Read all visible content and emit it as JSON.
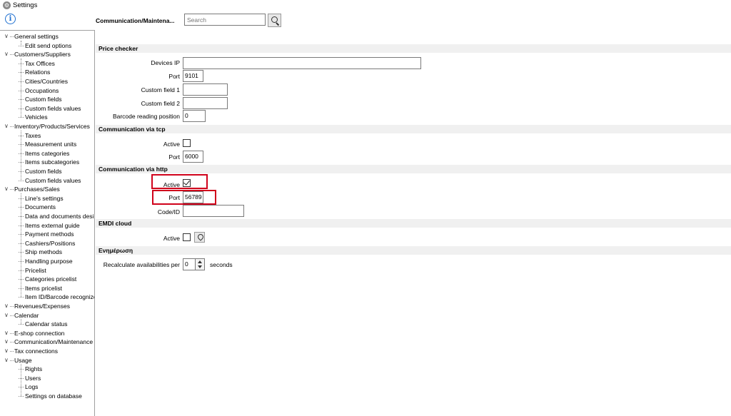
{
  "window": {
    "title": "Settings"
  },
  "header": {
    "breadcrumb": "Communication/Maintena...",
    "search_placeholder": "Search"
  },
  "tree": [
    {
      "label": "General settings",
      "children": [
        "Edit send options"
      ]
    },
    {
      "label": "Customers/Suppliers",
      "children": [
        "Tax Offices",
        "Relations",
        "Cities/Countries",
        "Occupations",
        "Custom fields",
        "Custom fields values",
        "Vehicles"
      ]
    },
    {
      "label": "Inventory/Products/Services",
      "children": [
        "Taxes",
        "Measurement units",
        "Items categories",
        "Items subcategories",
        "Custom fields",
        "Custom fields values"
      ]
    },
    {
      "label": "Purchases/Sales",
      "children": [
        "Line's settings",
        "Documents",
        "Data and documents desi",
        "Items external guide",
        "Payment methods",
        "Cashiers/Positions",
        "Ship methods",
        "Handling purpose",
        "Pricelist",
        "Categories pricelist",
        "Items pricelist",
        "Item ID/Barcode recognize"
      ]
    },
    {
      "label": "Revenues/Expenses",
      "children": []
    },
    {
      "label": "Calendar",
      "children": [
        "Calendar status"
      ]
    },
    {
      "label": "E-shop connection",
      "children": []
    },
    {
      "label": "Communication/Maintenance",
      "children": []
    },
    {
      "label": "Tax connections",
      "children": []
    },
    {
      "label": "Usage",
      "children": [
        "Rights",
        "Users",
        "Logs",
        "Settings on database"
      ]
    }
  ],
  "sections": {
    "price_checker": {
      "title": "Price checker",
      "devices_ip_label": "Devices IP",
      "devices_ip_value": "",
      "port_label": "Port",
      "port_value": "9101",
      "custom1_label": "Custom field 1",
      "custom1_value": "",
      "custom2_label": "Custom field 2",
      "custom2_value": "",
      "barcode_label": "Barcode reading position",
      "barcode_value": "0"
    },
    "tcp": {
      "title": "Communication via tcp",
      "active_label": "Active",
      "active": false,
      "port_label": "Port",
      "port_value": "6000"
    },
    "http": {
      "title": "Communication via http",
      "active_label": "Active",
      "active": true,
      "port_label": "Port",
      "port_value": "56789",
      "code_label": "Code/ID",
      "code_value": ""
    },
    "emdi": {
      "title": "EMDI cloud",
      "active_label": "Active",
      "active": false,
      "location_icon": "location-pin-icon"
    },
    "update": {
      "title": "Ενημέρωση",
      "recalc_label": "Recalculate availabilities per",
      "recalc_value": "0",
      "unit": "seconds"
    }
  },
  "colors": {
    "highlight": "#d0021b",
    "info_blue": "#1e6fd0",
    "section_bg": "#f0f0f0"
  }
}
